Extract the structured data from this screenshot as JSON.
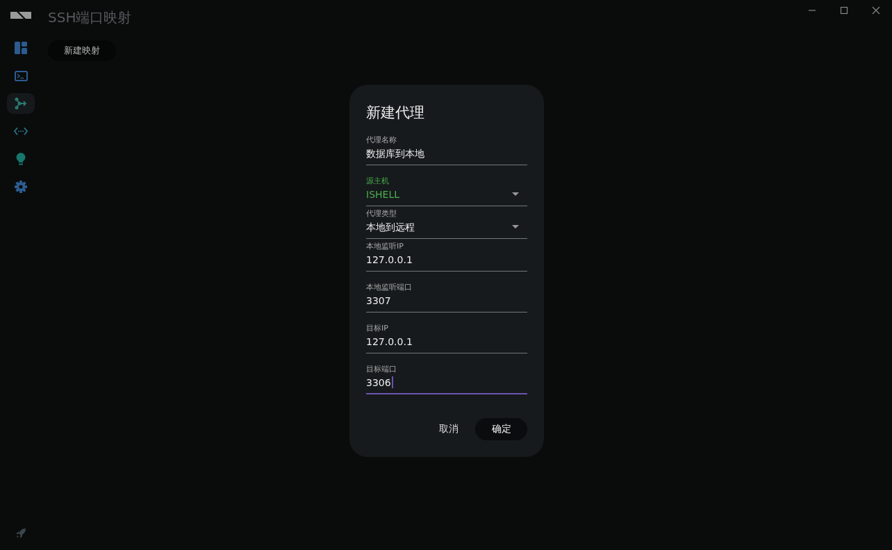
{
  "window": {
    "title": "SSH端口映射"
  },
  "sidebar": {
    "items": [
      {
        "kind": "dashboard",
        "selected": false
      },
      {
        "kind": "terminal",
        "selected": false
      },
      {
        "kind": "forward",
        "selected": true
      },
      {
        "kind": "code",
        "selected": false
      },
      {
        "kind": "bulb",
        "selected": false
      },
      {
        "kind": "settings",
        "selected": false
      }
    ]
  },
  "toolbar": {
    "new_button": "新建映射"
  },
  "dialog": {
    "title": "新建代理",
    "fields": [
      {
        "kind": "text",
        "label": "代理名称",
        "value": "数据库到本地",
        "focused": false,
        "highlighted": false
      },
      {
        "kind": "select",
        "label": "源主机",
        "value": "ISHELL",
        "focused": false,
        "highlighted": true
      },
      {
        "kind": "select",
        "label": "代理类型",
        "value": "本地到远程",
        "focused": false,
        "highlighted": false
      },
      {
        "kind": "text",
        "label": "本地监听IP",
        "value": "127.0.0.1",
        "focused": false,
        "highlighted": false
      },
      {
        "kind": "text",
        "label": "本地监听端口",
        "value": "3307",
        "focused": false,
        "highlighted": false
      },
      {
        "kind": "text",
        "label": "目标IP",
        "value": "127.0.0.1",
        "focused": false,
        "highlighted": false
      },
      {
        "kind": "text",
        "label": "目标端口",
        "value": "3306",
        "focused": true,
        "highlighted": false
      }
    ],
    "cancel": "取消",
    "confirm": "确定"
  }
}
